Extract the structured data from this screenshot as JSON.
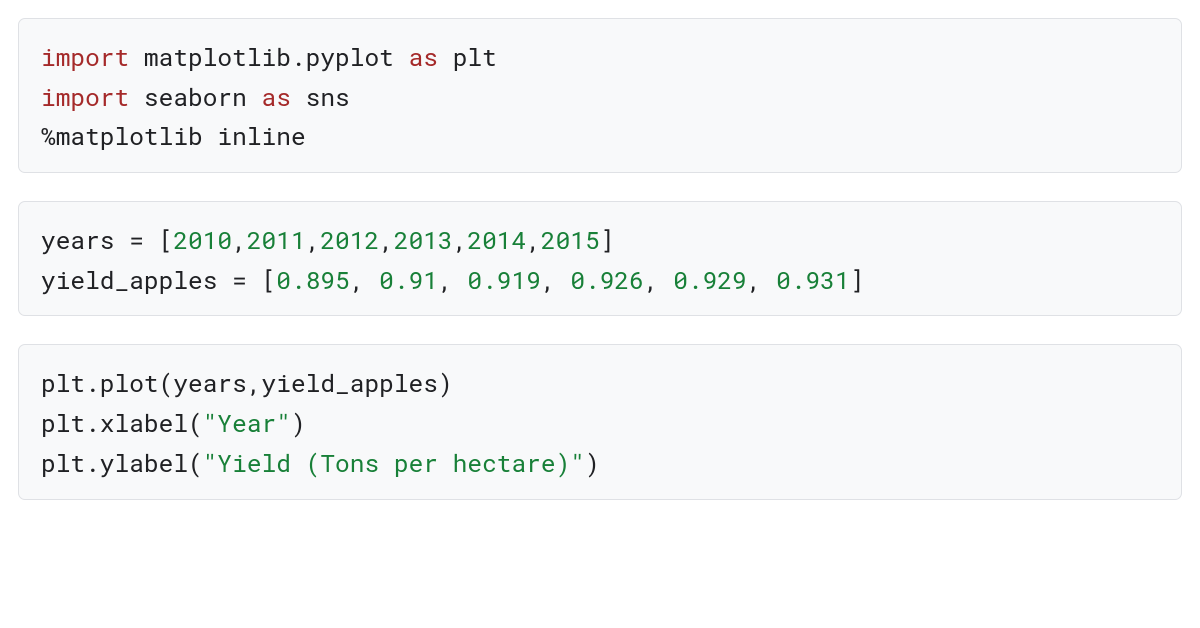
{
  "cells": [
    {
      "lines": [
        [
          {
            "cls": "kw",
            "t": "import"
          },
          {
            "cls": "op",
            "t": " "
          },
          {
            "cls": "mod",
            "t": "matplotlib.pyplot"
          },
          {
            "cls": "op",
            "t": " "
          },
          {
            "cls": "kw",
            "t": "as"
          },
          {
            "cls": "op",
            "t": " "
          },
          {
            "cls": "mod",
            "t": "plt"
          }
        ],
        [
          {
            "cls": "kw",
            "t": "import"
          },
          {
            "cls": "op",
            "t": " "
          },
          {
            "cls": "mod",
            "t": "seaborn"
          },
          {
            "cls": "op",
            "t": " "
          },
          {
            "cls": "kw",
            "t": "as"
          },
          {
            "cls": "op",
            "t": " "
          },
          {
            "cls": "mod",
            "t": "sns"
          }
        ],
        [
          {
            "cls": "magic",
            "t": "%matplotlib inline"
          }
        ]
      ]
    },
    {
      "lines": [
        [
          {
            "cls": "mod",
            "t": "years"
          },
          {
            "cls": "op",
            "t": " = ["
          },
          {
            "cls": "num",
            "t": "2010"
          },
          {
            "cls": "op",
            "t": ","
          },
          {
            "cls": "num",
            "t": "2011"
          },
          {
            "cls": "op",
            "t": ","
          },
          {
            "cls": "num",
            "t": "2012"
          },
          {
            "cls": "op",
            "t": ","
          },
          {
            "cls": "num",
            "t": "2013"
          },
          {
            "cls": "op",
            "t": ","
          },
          {
            "cls": "num",
            "t": "2014"
          },
          {
            "cls": "op",
            "t": ","
          },
          {
            "cls": "num",
            "t": "2015"
          },
          {
            "cls": "op",
            "t": "]"
          }
        ],
        [
          {
            "cls": "mod",
            "t": "yield_apples"
          },
          {
            "cls": "op",
            "t": " = ["
          },
          {
            "cls": "num",
            "t": "0.895"
          },
          {
            "cls": "op",
            "t": ", "
          },
          {
            "cls": "num",
            "t": "0.91"
          },
          {
            "cls": "op",
            "t": ", "
          },
          {
            "cls": "num",
            "t": "0.919"
          },
          {
            "cls": "op",
            "t": ", "
          },
          {
            "cls": "num",
            "t": "0.926"
          },
          {
            "cls": "op",
            "t": ", "
          },
          {
            "cls": "num",
            "t": "0.929"
          },
          {
            "cls": "op",
            "t": ", "
          },
          {
            "cls": "num",
            "t": "0.931"
          },
          {
            "cls": "op",
            "t": "]"
          }
        ]
      ]
    },
    {
      "lines": [
        [
          {
            "cls": "mod",
            "t": "plt.plot(years,yield_apples)"
          }
        ],
        [
          {
            "cls": "mod",
            "t": "plt.xlabel("
          },
          {
            "cls": "str",
            "t": "\"Year\""
          },
          {
            "cls": "mod",
            "t": ")"
          }
        ],
        [
          {
            "cls": "mod",
            "t": "plt.ylabel("
          },
          {
            "cls": "str",
            "t": "\"Yield (Tons per hectare)\""
          },
          {
            "cls": "mod",
            "t": ")"
          }
        ]
      ]
    }
  ]
}
